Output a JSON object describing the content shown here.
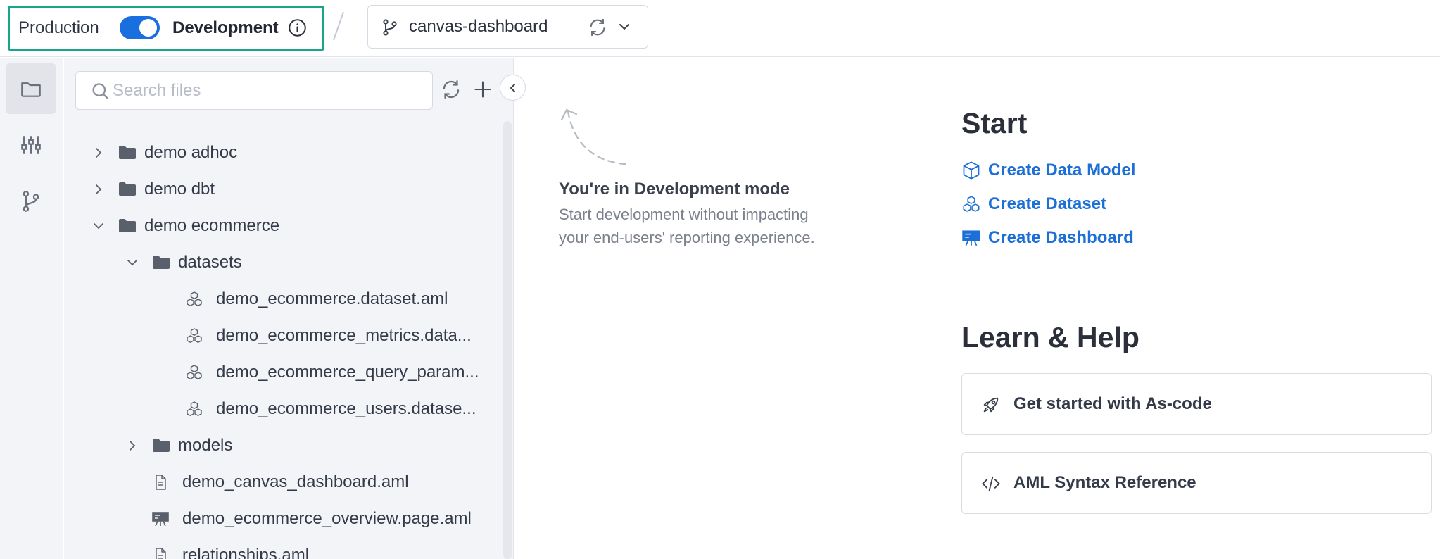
{
  "topbar": {
    "production_label": "Production",
    "development_label": "Development",
    "mode_toggle_on": true,
    "branch_name": "canvas-dashboard"
  },
  "rail": {
    "items": [
      {
        "icon": "folder-icon",
        "active": true
      },
      {
        "icon": "sliders-icon",
        "active": false
      },
      {
        "icon": "git-branch-icon",
        "active": false
      }
    ]
  },
  "filepanel": {
    "search_placeholder": "Search files",
    "tree": [
      {
        "label": "demo adhoc",
        "type": "folder",
        "expanded": false
      },
      {
        "label": "demo dbt",
        "type": "folder",
        "expanded": false
      },
      {
        "label": "demo ecommerce",
        "type": "folder",
        "expanded": true
      },
      {
        "label": "datasets",
        "type": "folder",
        "expanded": true
      },
      {
        "label": "demo_ecommerce.dataset.aml",
        "type": "dataset"
      },
      {
        "label": "demo_ecommerce_metrics.data...",
        "type": "dataset"
      },
      {
        "label": "demo_ecommerce_query_param...",
        "type": "dataset"
      },
      {
        "label": "demo_ecommerce_users.datase...",
        "type": "dataset"
      },
      {
        "label": "models",
        "type": "folder",
        "expanded": false
      },
      {
        "label": "demo_canvas_dashboard.aml",
        "type": "file"
      },
      {
        "label": "demo_ecommerce_overview.page.aml",
        "type": "dashboard"
      },
      {
        "label": "relationships.aml",
        "type": "file"
      }
    ]
  },
  "main": {
    "dev_title": "You're in Development mode",
    "dev_description": "Start development without impacting your end-users' reporting experience.",
    "start_heading": "Start",
    "start_links": [
      {
        "label": "Create Data Model",
        "icon": "cube-icon"
      },
      {
        "label": "Create Dataset",
        "icon": "dataset-icon"
      },
      {
        "label": "Create Dashboard",
        "icon": "dashboard-icon"
      }
    ],
    "learn_heading": "Learn & Help",
    "help_cards": [
      {
        "label": "Get started with As-code",
        "icon": "rocket-icon"
      },
      {
        "label": "AML Syntax Reference",
        "icon": "code-icon"
      }
    ]
  },
  "colors": {
    "accent_blue": "#1a6fe0",
    "link_blue": "#1c6fd6",
    "mode_highlight": "#17a58c",
    "panel_bg": "#f3f4f7"
  }
}
